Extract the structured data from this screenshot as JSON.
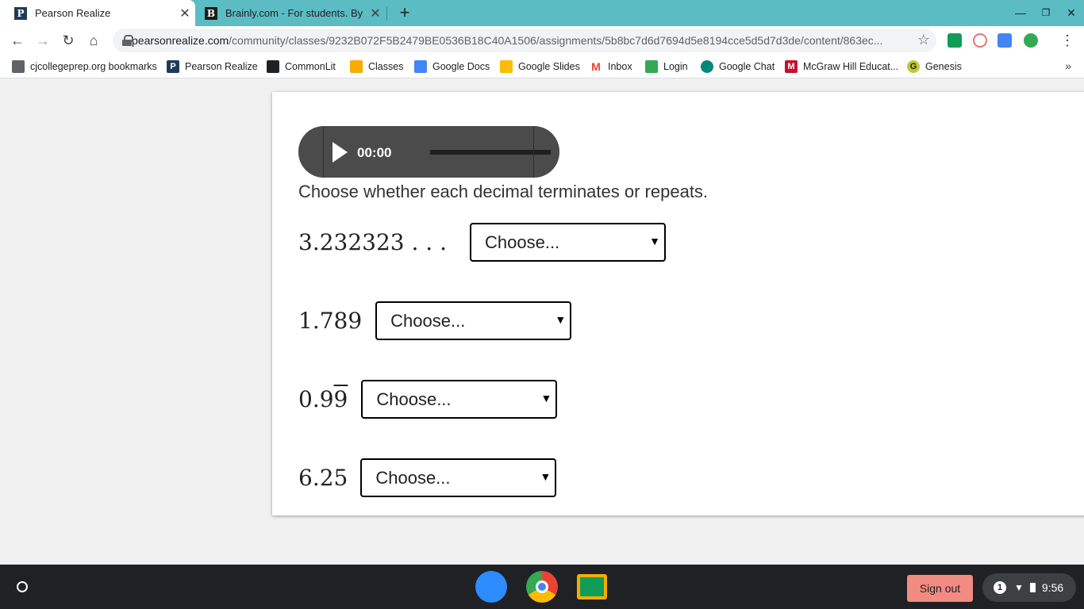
{
  "tabs": [
    {
      "title": "Pearson Realize",
      "favicon": "P",
      "close": "✕"
    },
    {
      "title": "Brainly.com - For students. By st",
      "favicon": "B",
      "close": "✕"
    }
  ],
  "toolbar": {
    "url_host": "pearsonrealize.com",
    "url_path": "/community/classes/9232B072F5B2479BE0536B18C40A1506/assignments/5b8bc7d6d7694d5e8194cce5d5d7d3de/content/863ec..."
  },
  "bookmarks": [
    {
      "label": "cjcollegeprep.org bookmarks",
      "icon": "folder-icon",
      "color": "#5f6368"
    },
    {
      "label": "Pearson Realize",
      "icon": "pearson-icon",
      "color": "#1f3b5a"
    },
    {
      "label": "CommonLit",
      "icon": "book-icon",
      "color": "#202124"
    },
    {
      "label": "Classes",
      "icon": "classroom-icon",
      "color": "#f9ab00"
    },
    {
      "label": "Google Docs",
      "icon": "docs-icon",
      "color": "#4285f4"
    },
    {
      "label": "Google Slides",
      "icon": "slides-icon",
      "color": "#fbbc04"
    },
    {
      "label": "Inbox",
      "icon": "gmail-icon",
      "color": "#ea4335"
    },
    {
      "label": "Login",
      "icon": "login-icon",
      "color": "#34a853"
    },
    {
      "label": "Google Chat",
      "icon": "chat-icon",
      "color": "#00897b"
    },
    {
      "label": "McGraw Hill Educat...",
      "icon": "mcgraw-icon",
      "color": "#c5112b"
    },
    {
      "label": "Genesis",
      "icon": "genesis-icon",
      "color": "#c0ca33"
    }
  ],
  "audio": {
    "time": "00:00"
  },
  "question": {
    "prompt": "Choose whether each decimal terminates or repeats.",
    "items": [
      {
        "number": "3.232323 . . .",
        "placeholder": "Choose..."
      },
      {
        "number": "1.789",
        "placeholder": "Choose..."
      },
      {
        "number_main": "0.9",
        "number_over": "9",
        "placeholder": "Choose..."
      },
      {
        "number": "6.25",
        "placeholder": "Choose..."
      }
    ]
  },
  "shelf": {
    "signout": "Sign out",
    "notifications": "1",
    "clock": "9:56"
  }
}
